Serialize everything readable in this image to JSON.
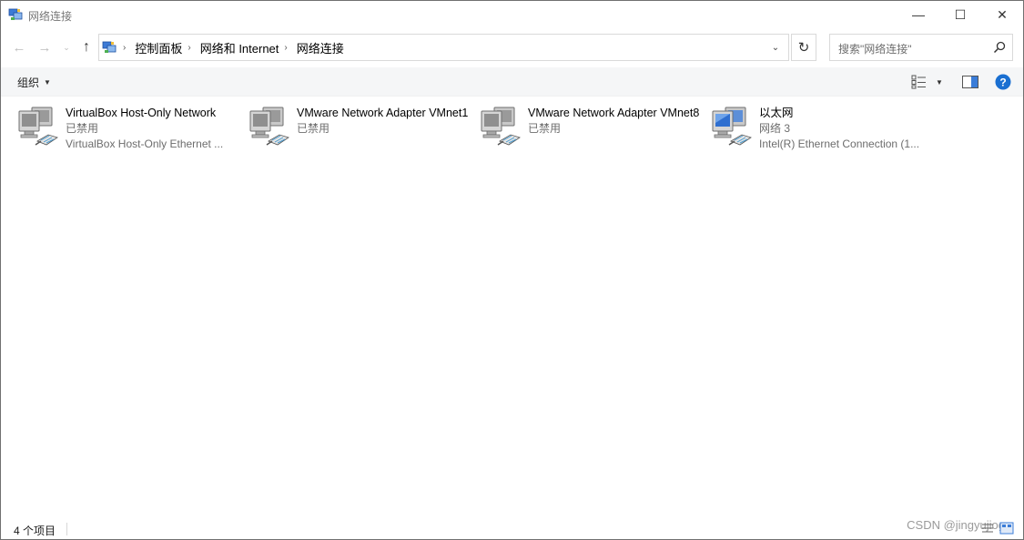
{
  "window": {
    "title": "网络连接",
    "minimize_glyph": "—",
    "maximize_glyph": "☐",
    "close_glyph": "✕"
  },
  "nav": {
    "back_glyph": "←",
    "forward_glyph": "→",
    "recent_glyph": "⌄",
    "up_glyph": "↑"
  },
  "address": {
    "breadcrumbs": [
      "控制面板",
      "网络和 Internet",
      "网络连接"
    ],
    "separator": "›",
    "dropdown_glyph": "⌄",
    "refresh_glyph": "↻"
  },
  "search": {
    "placeholder": "搜索\"网络连接\""
  },
  "toolbar": {
    "organize_label": "组织",
    "organize_arrow": "▼",
    "view_arrow": "▼",
    "help_glyph": "?"
  },
  "connections": [
    {
      "name": "VirtualBox Host-Only Network",
      "status": "已禁用",
      "device": "VirtualBox Host-Only Ethernet ...",
      "icon": "network-adapter-disabled-icon"
    },
    {
      "name": "VMware Network Adapter VMnet1",
      "status": "已禁用",
      "device": "",
      "icon": "network-adapter-disabled-icon"
    },
    {
      "name": "VMware Network Adapter VMnet8",
      "status": "已禁用",
      "device": "",
      "icon": "network-adapter-disabled-icon"
    },
    {
      "name": "以太网",
      "status": "网络 3",
      "device": "Intel(R) Ethernet Connection (1...",
      "icon": "network-adapter-connected-icon"
    }
  ],
  "statusbar": {
    "item_count": "4 个项目",
    "watermark": "CSDN @jingyujiog"
  },
  "colors": {
    "toolbar_bg": "#f5f6f7",
    "help_blue": "#1a6fd1",
    "monitor_gray": "#8f8f8f",
    "monitor_blue": "#2f6fd0"
  }
}
